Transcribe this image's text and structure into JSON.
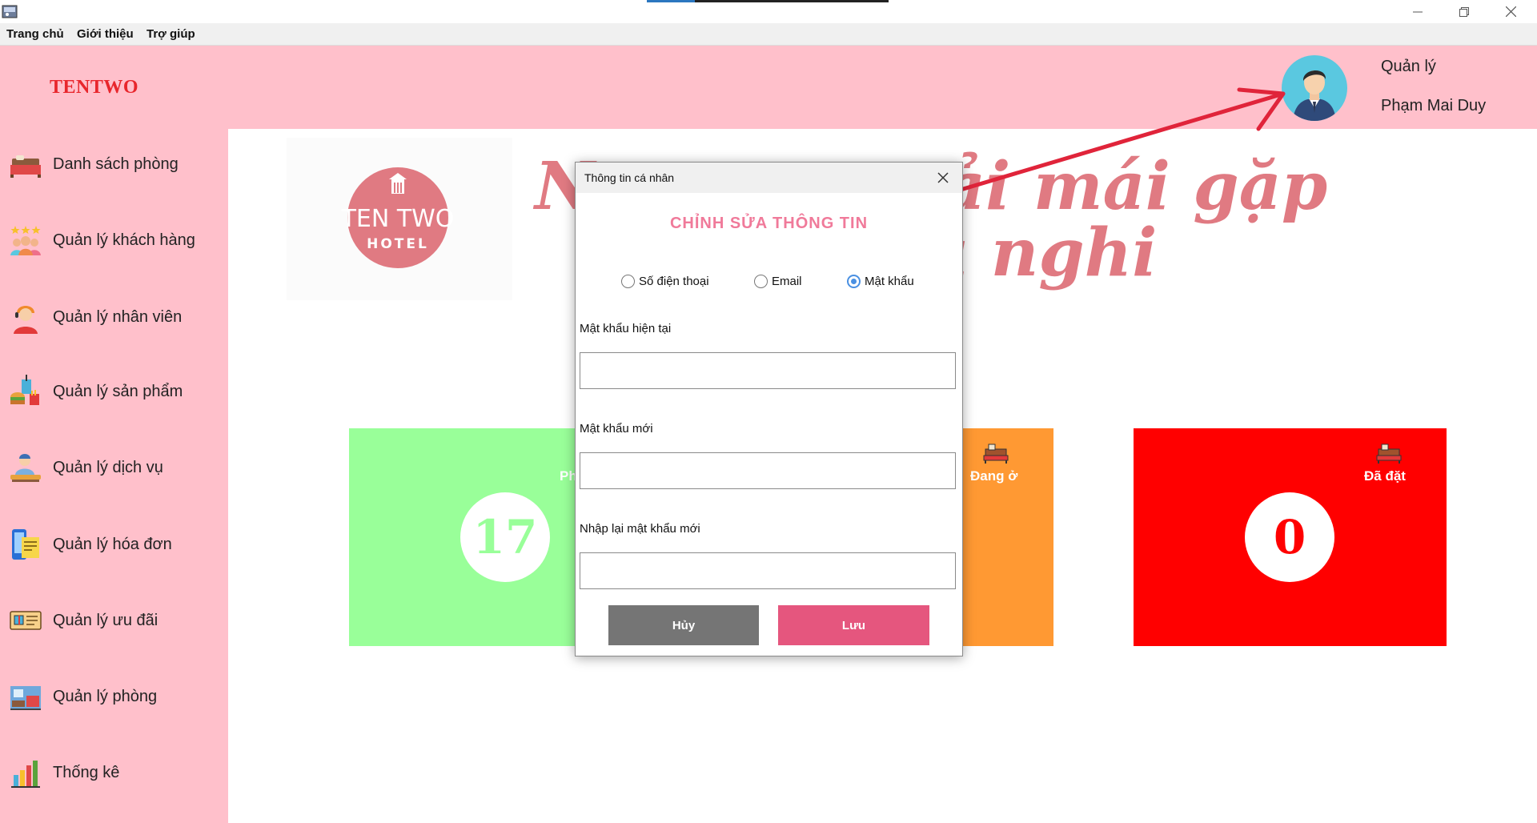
{
  "menu": {
    "items": [
      "Trang chủ",
      "Giới thiệu",
      "Trợ giúp"
    ]
  },
  "header": {
    "brand": "TENTWO",
    "role": "Quản lý",
    "username": "Phạm Mai Duy"
  },
  "sidebar": {
    "items": [
      {
        "label": "Danh sách phòng",
        "icon": "bed-icon"
      },
      {
        "label": "Quản lý khách hàng",
        "icon": "customers-icon"
      },
      {
        "label": "Quản lý nhân viên",
        "icon": "staff-icon"
      },
      {
        "label": "Quản lý sản phẩm",
        "icon": "products-icon"
      },
      {
        "label": "Quản lý dịch vụ",
        "icon": "service-icon"
      },
      {
        "label": "Quản lý hóa đơn",
        "icon": "invoice-icon"
      },
      {
        "label": "Quản lý ưu đãi",
        "icon": "voucher-icon"
      },
      {
        "label": "Quản lý phòng",
        "icon": "room-icon"
      },
      {
        "label": "Thống kê",
        "icon": "chart-icon"
      }
    ]
  },
  "logo": {
    "line1": "TEN TWO",
    "line2": "HOTEL"
  },
  "banner": {
    "line1_left": "N",
    "line1_right": "ải mái gặp",
    "line2": "ı nghi"
  },
  "stats": {
    "available": {
      "label": "Ph",
      "value": "17",
      "color": "#99ff99",
      "text_color": "#99ff99"
    },
    "occupied": {
      "label": "Đang ở",
      "color": "#ff9933"
    },
    "booked": {
      "label": "Đã đặt",
      "value": "0",
      "color": "#ff0000",
      "text_color": "#ff0000"
    }
  },
  "dialog": {
    "title": "Thông tin cá nhân",
    "heading": "CHỈNH SỬA THÔNG TIN",
    "options": [
      "Số điện thoại",
      "Email",
      "Mật khẩu"
    ],
    "selected_option": "Mật khẩu",
    "fields": [
      {
        "label": "Mật khẩu hiện tại",
        "value": ""
      },
      {
        "label": "Mật khẩu mới",
        "value": ""
      },
      {
        "label": "Nhập lại mật khẩu mới",
        "value": ""
      }
    ],
    "cancel_label": "Hủy",
    "save_label": "Lưu"
  },
  "colors": {
    "pink_bg": "#ffc0cb",
    "brand_red": "#e8262c",
    "heading_pink": "#f07a9a",
    "cancel_gray": "#757575",
    "save_pink": "#e5567e",
    "arrow_red": "#e0243a",
    "banner_pink": "#e07a82"
  }
}
